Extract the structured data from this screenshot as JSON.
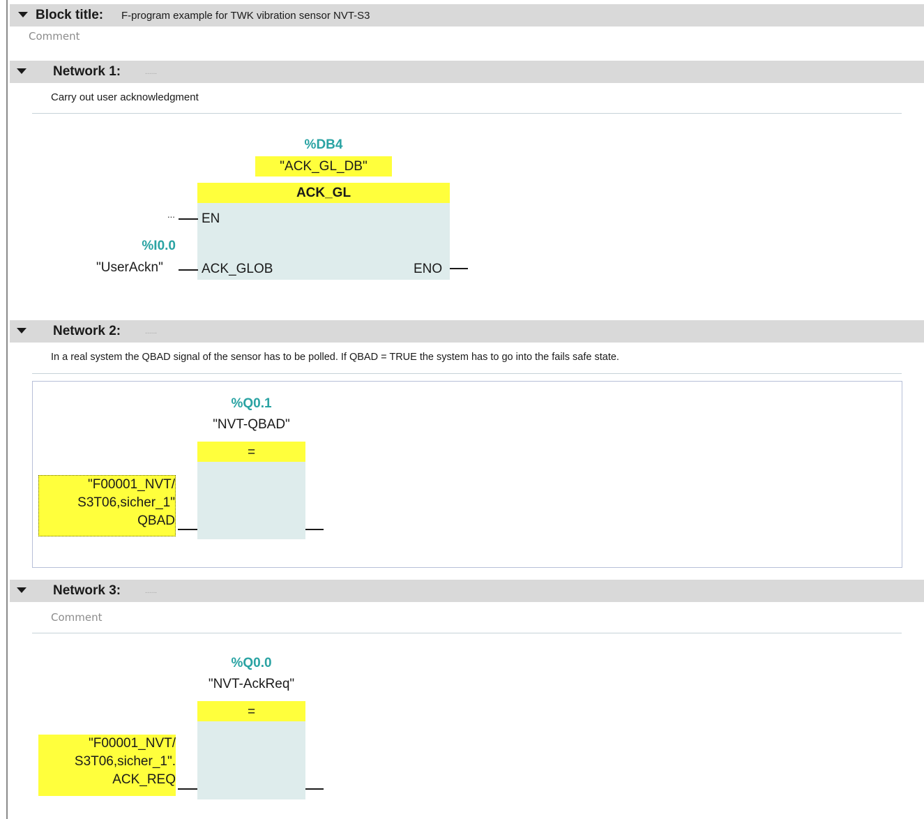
{
  "block": {
    "label": "Block title:",
    "title": "F-program example for TWK vibration sensor NVT-S3",
    "comment": "Comment"
  },
  "networks": [
    {
      "label": "Network 1:",
      "dots": "......",
      "comment": "Carry out user acknowledgment",
      "instance_addr": "%DB4",
      "instance_name": "\"ACK_GL_DB\"",
      "box_title": "ACK_GL",
      "en_operand": "...",
      "en_pin": "EN",
      "input_addr": "%I0.0",
      "input_name": "\"UserAckn\"",
      "input_pin": "ACK_GLOB",
      "output_pin": "ENO"
    },
    {
      "label": "Network 2:",
      "dots": "......",
      "comment": "In a real system the QBAD signal of the sensor has to be polled. If QBAD = TRUE the system has to go into the fails safe state.",
      "coil_addr": "%Q0.1",
      "coil_name": "\"NVT-QBAD\"",
      "box_title": "=",
      "operand_line1": "\"F00001_NVT/",
      "operand_line2": "S3T06,sicher_1\"",
      "operand_line3": "QBAD"
    },
    {
      "label": "Network 3:",
      "dots": "......",
      "comment": "Comment",
      "coil_addr": "%Q0.0",
      "coil_name": "\"NVT-AckReq\"",
      "box_title": "=",
      "operand_line1": "\"F00001_NVT/",
      "operand_line2": "S3T06,sicher_1\".",
      "operand_line3": "ACK_REQ"
    }
  ]
}
